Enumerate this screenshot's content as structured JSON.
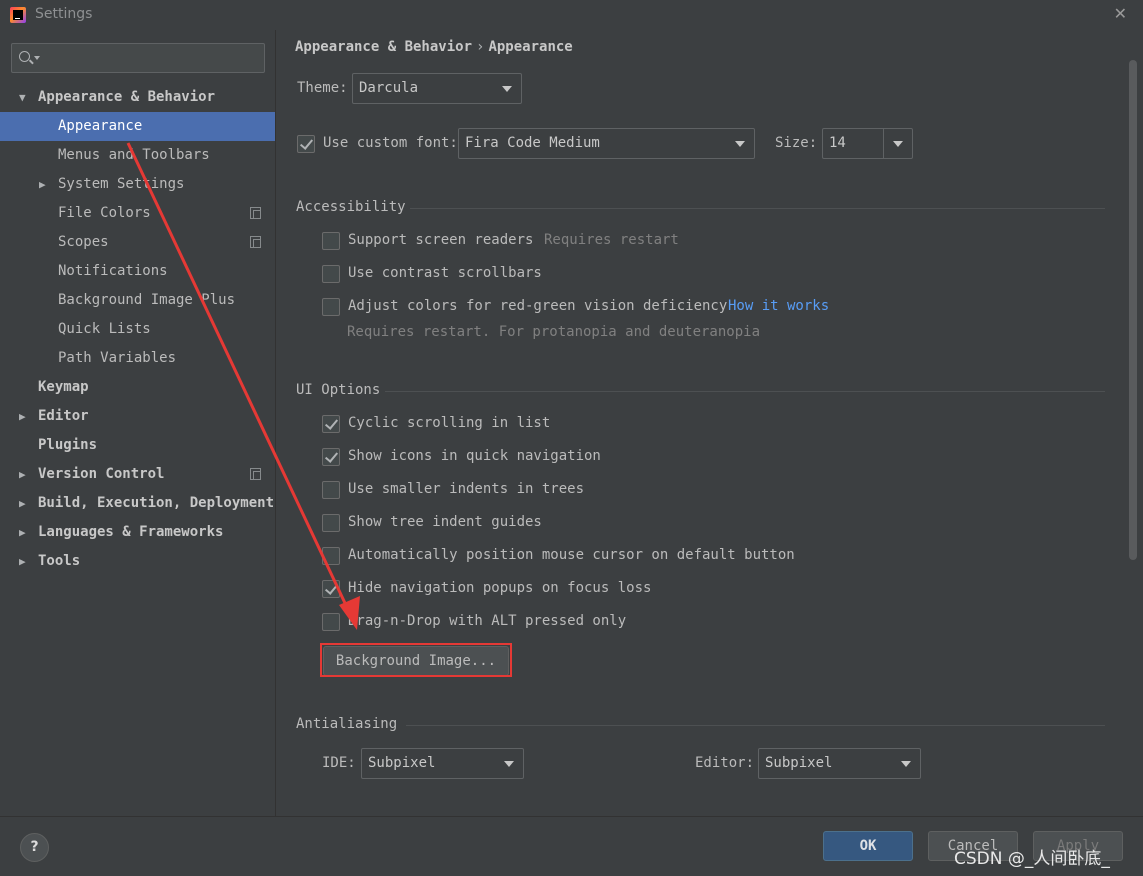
{
  "window": {
    "title": "Settings"
  },
  "search": {
    "placeholder": ""
  },
  "sidebar": {
    "items": [
      {
        "label": "Appearance & Behavior",
        "expanded": true,
        "bold": true
      },
      {
        "label": "Appearance",
        "selected": true
      },
      {
        "label": "Menus and Toolbars"
      },
      {
        "label": "System Settings",
        "collapsed": true
      },
      {
        "label": "File Colors",
        "copy_icon": true
      },
      {
        "label": "Scopes",
        "copy_icon": true
      },
      {
        "label": "Notifications"
      },
      {
        "label": "Background Image Plus"
      },
      {
        "label": "Quick Lists"
      },
      {
        "label": "Path Variables"
      },
      {
        "label": "Keymap",
        "bold": true
      },
      {
        "label": "Editor",
        "bold": true,
        "collapsed": true
      },
      {
        "label": "Plugins",
        "bold": true
      },
      {
        "label": "Version Control",
        "bold": true,
        "collapsed": true,
        "copy_icon": true
      },
      {
        "label": "Build, Execution, Deployment",
        "bold": true,
        "collapsed": true
      },
      {
        "label": "Languages & Frameworks",
        "bold": true,
        "collapsed": true
      },
      {
        "label": "Tools",
        "bold": true,
        "collapsed": true
      }
    ]
  },
  "breadcrumb": {
    "parent": "Appearance & Behavior",
    "separator": "›",
    "current": "Appearance"
  },
  "theme": {
    "label": "Theme:",
    "value": "Darcula"
  },
  "font": {
    "checkbox_label": "Use custom font:",
    "checked": true,
    "value": "Fira Code Medium",
    "size_label": "Size:",
    "size_value": "14"
  },
  "accessibility": {
    "title": "Accessibility",
    "screen_readers": {
      "label": "Support screen readers",
      "hint": "Requires restart",
      "checked": false
    },
    "contrast_scrollbars": {
      "label": "Use contrast scrollbars",
      "checked": false
    },
    "color_deficiency": {
      "label": "Adjust colors for red-green vision deficiency",
      "link": "How it works",
      "hint": "Requires restart. For protanopia and deuteranopia",
      "checked": false
    }
  },
  "ui_options": {
    "title": "UI Options",
    "cyclic_scrolling": {
      "label": "Cyclic scrolling in list",
      "checked": true
    },
    "show_icons": {
      "label": "Show icons in quick navigation",
      "checked": true
    },
    "smaller_indents": {
      "label": "Use smaller indents in trees",
      "checked": false
    },
    "indent_guides": {
      "label": "Show tree indent guides",
      "checked": false
    },
    "auto_mouse": {
      "label": "Automatically position mouse cursor on default button",
      "checked": false
    },
    "hide_popups": {
      "label": "Hide navigation popups on focus loss",
      "checked": true
    },
    "drag_drop": {
      "label": "Drag-n-Drop with ALT pressed only",
      "checked": false
    },
    "background_button": "Background Image..."
  },
  "antialiasing": {
    "title": "Antialiasing",
    "ide_label": "IDE:",
    "ide_value": "Subpixel",
    "editor_label": "Editor:",
    "editor_value": "Subpixel"
  },
  "footer": {
    "help": "?",
    "ok": "OK",
    "cancel": "Cancel",
    "apply": "Apply"
  },
  "watermark": "CSDN @_人间卧底_",
  "colors": {
    "selection": "#4b6eaf",
    "link": "#589df6",
    "annotation": "#e53935",
    "primary_button": "#365880"
  }
}
